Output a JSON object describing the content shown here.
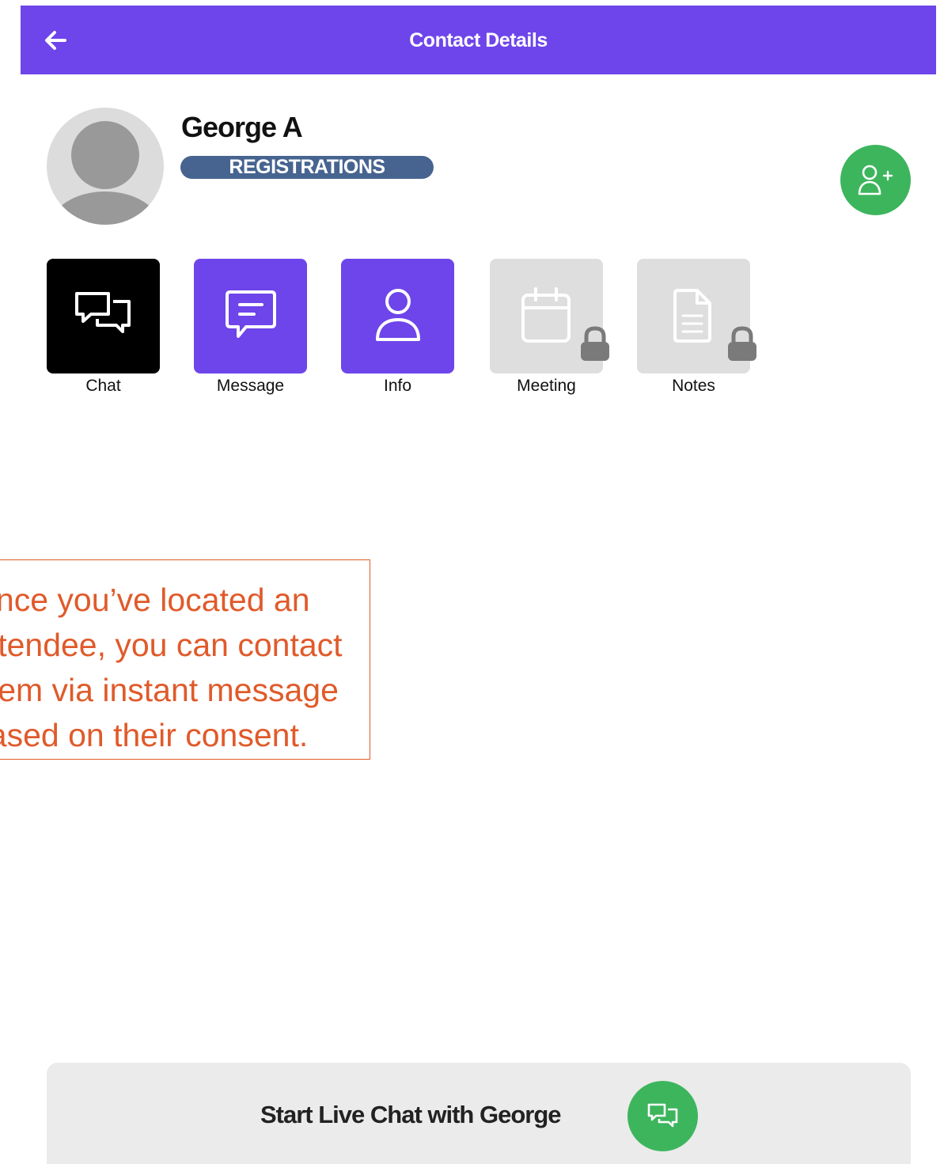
{
  "header": {
    "title": "Contact Details",
    "back_icon": "arrow-left-icon",
    "background_color": "#6d45ea"
  },
  "profile": {
    "name": "George A",
    "tag": "REGISTRATIONS",
    "tag_color": "#46648f",
    "avatar_icon": "avatar-placeholder-icon",
    "add_contact_icon": "user-plus-icon",
    "add_contact_color": "#3db55d"
  },
  "actions": [
    {
      "label": "Chat",
      "icon": "chat-bubbles-icon",
      "color": "#000000",
      "locked": false,
      "selected": true
    },
    {
      "label": "Message",
      "icon": "message-icon",
      "color": "#6d45ea",
      "locked": false
    },
    {
      "label": "Info",
      "icon": "user-icon",
      "color": "#6d45ea",
      "locked": false
    },
    {
      "label": "Meeting",
      "icon": "calendar-icon",
      "color": "#dedede",
      "locked": true
    },
    {
      "label": "Notes",
      "icon": "document-icon",
      "color": "#dedede",
      "locked": true
    }
  ],
  "callout": {
    "lines": [
      "Once you’ve located an",
      "attendee, you can contact",
      "them via instant message",
      "based on their consent."
    ],
    "color": "#e05a2a"
  },
  "chat_bar": {
    "label": "Start Live Chat with George",
    "icon": "chat-bubbles-icon",
    "icon_color": "#3db55d"
  }
}
